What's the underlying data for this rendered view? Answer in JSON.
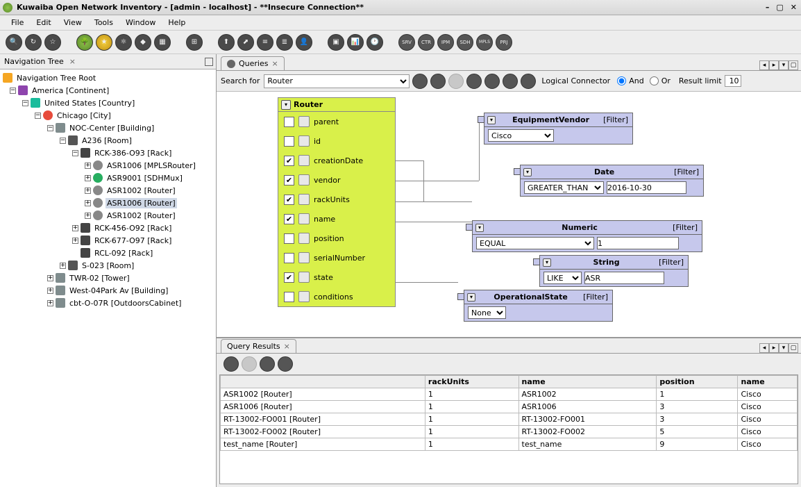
{
  "window": {
    "title": "Kuwaiba Open Network Inventory - [admin - localhost] - **Insecure Connection**"
  },
  "menu": [
    "File",
    "Edit",
    "View",
    "Tools",
    "Window",
    "Help"
  ],
  "nav": {
    "tab_title": "Navigation Tree",
    "root": "Navigation Tree Root",
    "nodes": {
      "america": "America [Continent]",
      "us": "United States [Country]",
      "chicago": "Chicago [City]",
      "noc": "NOC-Center [Building]",
      "a236": "A236 [Room]",
      "rck386": "RCK-386-O93 [Rack]",
      "asr1006m": "ASR1006 [MPLSRouter]",
      "asr9001": "ASR9001 [SDHMux]",
      "asr1002a": "ASR1002 [Router]",
      "asr1006r": "ASR1006 [Router]",
      "asr1002b": "ASR1002 [Router]",
      "rck456": "RCK-456-O92 [Rack]",
      "rck677": "RCK-677-O97 [Rack]",
      "rcl092": "RCL-092 [Rack]",
      "s023": "S-023 [Room]",
      "twr02": "TWR-02 [Tower]",
      "west04": "West-04Park Av [Building]",
      "cbto07": "cbt-O-07R [OutdoorsCabinet]"
    }
  },
  "queries_tab": "Queries",
  "search_for_label": "Search for",
  "search_for_value": "Router",
  "logical_connector_label": "Logical Connector",
  "and_label": "And",
  "or_label": "Or",
  "result_limit_label": "Result limit",
  "result_limit_value": "10",
  "router_box": {
    "title": "Router",
    "attrs": [
      {
        "label": "parent",
        "checked": false
      },
      {
        "label": "id",
        "checked": false
      },
      {
        "label": "creationDate",
        "checked": true
      },
      {
        "label": "vendor",
        "checked": true
      },
      {
        "label": "rackUnits",
        "checked": true
      },
      {
        "label": "name",
        "checked": true
      },
      {
        "label": "position",
        "checked": false
      },
      {
        "label": "serialNumber",
        "checked": false
      },
      {
        "label": "state",
        "checked": true
      },
      {
        "label": "conditions",
        "checked": false
      }
    ]
  },
  "filters": {
    "vendor": {
      "title": "EquipmentVendor",
      "tag": "[Filter]",
      "value": "Cisco"
    },
    "date": {
      "title": "Date",
      "tag": "[Filter]",
      "op": "GREATER_THAN",
      "value": "2016-10-30"
    },
    "numeric": {
      "title": "Numeric",
      "tag": "[Filter]",
      "op": "EQUAL",
      "value": "1"
    },
    "string": {
      "title": "String",
      "tag": "[Filter]",
      "op": "LIKE",
      "value": "ASR"
    },
    "opstate": {
      "title": "OperationalState",
      "tag": "[Filter]",
      "value": "None"
    }
  },
  "results_tab": "Query Results",
  "results": {
    "columns": [
      "",
      "rackUnits",
      "name",
      "position",
      "name"
    ],
    "rows": [
      [
        "ASR1002 [Router]",
        "1",
        "ASR1002",
        "1",
        "Cisco"
      ],
      [
        "ASR1006 [Router]",
        "1",
        "ASR1006",
        "3",
        "Cisco"
      ],
      [
        "RT-13002-FO001 [Router]",
        "1",
        "RT-13002-FO001",
        "3",
        "Cisco"
      ],
      [
        "RT-13002-FO002 [Router]",
        "1",
        "RT-13002-FO002",
        "5",
        "Cisco"
      ],
      [
        "test_name [Router]",
        "1",
        "test_name",
        "9",
        "Cisco"
      ]
    ]
  }
}
